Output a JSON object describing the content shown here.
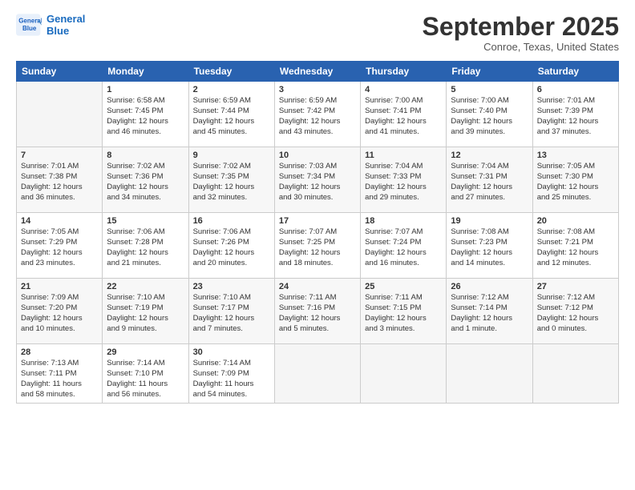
{
  "logo": {
    "line1": "General",
    "line2": "Blue"
  },
  "title": "September 2025",
  "subtitle": "Conroe, Texas, United States",
  "days": [
    "Sunday",
    "Monday",
    "Tuesday",
    "Wednesday",
    "Thursday",
    "Friday",
    "Saturday"
  ],
  "weeks": [
    [
      {
        "num": "",
        "text": ""
      },
      {
        "num": "1",
        "text": "Sunrise: 6:58 AM\nSunset: 7:45 PM\nDaylight: 12 hours\nand 46 minutes."
      },
      {
        "num": "2",
        "text": "Sunrise: 6:59 AM\nSunset: 7:44 PM\nDaylight: 12 hours\nand 45 minutes."
      },
      {
        "num": "3",
        "text": "Sunrise: 6:59 AM\nSunset: 7:42 PM\nDaylight: 12 hours\nand 43 minutes."
      },
      {
        "num": "4",
        "text": "Sunrise: 7:00 AM\nSunset: 7:41 PM\nDaylight: 12 hours\nand 41 minutes."
      },
      {
        "num": "5",
        "text": "Sunrise: 7:00 AM\nSunset: 7:40 PM\nDaylight: 12 hours\nand 39 minutes."
      },
      {
        "num": "6",
        "text": "Sunrise: 7:01 AM\nSunset: 7:39 PM\nDaylight: 12 hours\nand 37 minutes."
      }
    ],
    [
      {
        "num": "7",
        "text": "Sunrise: 7:01 AM\nSunset: 7:38 PM\nDaylight: 12 hours\nand 36 minutes."
      },
      {
        "num": "8",
        "text": "Sunrise: 7:02 AM\nSunset: 7:36 PM\nDaylight: 12 hours\nand 34 minutes."
      },
      {
        "num": "9",
        "text": "Sunrise: 7:02 AM\nSunset: 7:35 PM\nDaylight: 12 hours\nand 32 minutes."
      },
      {
        "num": "10",
        "text": "Sunrise: 7:03 AM\nSunset: 7:34 PM\nDaylight: 12 hours\nand 30 minutes."
      },
      {
        "num": "11",
        "text": "Sunrise: 7:04 AM\nSunset: 7:33 PM\nDaylight: 12 hours\nand 29 minutes."
      },
      {
        "num": "12",
        "text": "Sunrise: 7:04 AM\nSunset: 7:31 PM\nDaylight: 12 hours\nand 27 minutes."
      },
      {
        "num": "13",
        "text": "Sunrise: 7:05 AM\nSunset: 7:30 PM\nDaylight: 12 hours\nand 25 minutes."
      }
    ],
    [
      {
        "num": "14",
        "text": "Sunrise: 7:05 AM\nSunset: 7:29 PM\nDaylight: 12 hours\nand 23 minutes."
      },
      {
        "num": "15",
        "text": "Sunrise: 7:06 AM\nSunset: 7:28 PM\nDaylight: 12 hours\nand 21 minutes."
      },
      {
        "num": "16",
        "text": "Sunrise: 7:06 AM\nSunset: 7:26 PM\nDaylight: 12 hours\nand 20 minutes."
      },
      {
        "num": "17",
        "text": "Sunrise: 7:07 AM\nSunset: 7:25 PM\nDaylight: 12 hours\nand 18 minutes."
      },
      {
        "num": "18",
        "text": "Sunrise: 7:07 AM\nSunset: 7:24 PM\nDaylight: 12 hours\nand 16 minutes."
      },
      {
        "num": "19",
        "text": "Sunrise: 7:08 AM\nSunset: 7:23 PM\nDaylight: 12 hours\nand 14 minutes."
      },
      {
        "num": "20",
        "text": "Sunrise: 7:08 AM\nSunset: 7:21 PM\nDaylight: 12 hours\nand 12 minutes."
      }
    ],
    [
      {
        "num": "21",
        "text": "Sunrise: 7:09 AM\nSunset: 7:20 PM\nDaylight: 12 hours\nand 10 minutes."
      },
      {
        "num": "22",
        "text": "Sunrise: 7:10 AM\nSunset: 7:19 PM\nDaylight: 12 hours\nand 9 minutes."
      },
      {
        "num": "23",
        "text": "Sunrise: 7:10 AM\nSunset: 7:17 PM\nDaylight: 12 hours\nand 7 minutes."
      },
      {
        "num": "24",
        "text": "Sunrise: 7:11 AM\nSunset: 7:16 PM\nDaylight: 12 hours\nand 5 minutes."
      },
      {
        "num": "25",
        "text": "Sunrise: 7:11 AM\nSunset: 7:15 PM\nDaylight: 12 hours\nand 3 minutes."
      },
      {
        "num": "26",
        "text": "Sunrise: 7:12 AM\nSunset: 7:14 PM\nDaylight: 12 hours\nand 1 minute."
      },
      {
        "num": "27",
        "text": "Sunrise: 7:12 AM\nSunset: 7:12 PM\nDaylight: 12 hours\nand 0 minutes."
      }
    ],
    [
      {
        "num": "28",
        "text": "Sunrise: 7:13 AM\nSunset: 7:11 PM\nDaylight: 11 hours\nand 58 minutes."
      },
      {
        "num": "29",
        "text": "Sunrise: 7:14 AM\nSunset: 7:10 PM\nDaylight: 11 hours\nand 56 minutes."
      },
      {
        "num": "30",
        "text": "Sunrise: 7:14 AM\nSunset: 7:09 PM\nDaylight: 11 hours\nand 54 minutes."
      },
      {
        "num": "",
        "text": ""
      },
      {
        "num": "",
        "text": ""
      },
      {
        "num": "",
        "text": ""
      },
      {
        "num": "",
        "text": ""
      }
    ]
  ]
}
